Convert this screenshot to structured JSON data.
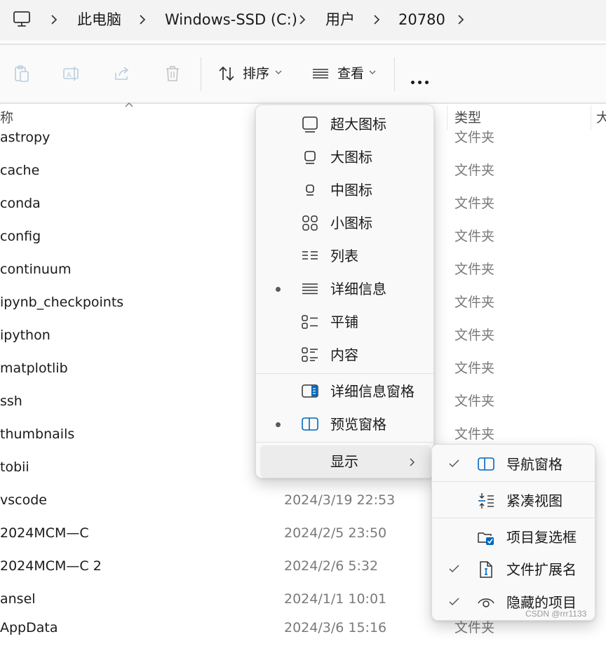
{
  "breadcrumb": {
    "root_icon": "computer-icon",
    "items": [
      "此电脑",
      "Windows-SSD (C:)",
      "用户",
      "20780"
    ]
  },
  "toolbar": {
    "sort_label": "排序",
    "view_label": "查看",
    "icons": [
      "paste-icon",
      "rename-icon",
      "share-icon",
      "delete-icon",
      "sort-icon",
      "view-icon",
      "more-icon"
    ]
  },
  "columns": {
    "name": "称",
    "type": "类型",
    "size": "大"
  },
  "files": [
    {
      "name": "astropy",
      "date": "",
      "type": "文件夹"
    },
    {
      "name": "cache",
      "date": "",
      "type": "文件夹"
    },
    {
      "name": "conda",
      "date": "",
      "type": "文件夹"
    },
    {
      "name": "config",
      "date": "",
      "type": "文件夹"
    },
    {
      "name": "continuum",
      "date": "",
      "type": "文件夹"
    },
    {
      "name": "ipynb_checkpoints",
      "date": "",
      "type": "文件夹"
    },
    {
      "name": "ipython",
      "date": "",
      "type": "文件夹"
    },
    {
      "name": "matplotlib",
      "date": "",
      "type": "文件夹"
    },
    {
      "name": "ssh",
      "date": "",
      "type": "文件夹"
    },
    {
      "name": "thumbnails",
      "date": "",
      "type": "文件夹"
    },
    {
      "name": "tobii",
      "date": "",
      "type": ""
    },
    {
      "name": "vscode",
      "date": "2024/3/19 22:53",
      "type": ""
    },
    {
      "name": "2024MCM—C",
      "date": "2024/2/5 23:50",
      "type": ""
    },
    {
      "name": "2024MCM—C  2",
      "date": "2024/2/6 5:32",
      "type": ""
    },
    {
      "name": "ansel",
      "date": "2024/1/1 10:01",
      "type": ""
    },
    {
      "name": "AppData",
      "date": "2024/3/6 15:16",
      "type": "文件夹"
    }
  ],
  "view_menu": {
    "items": [
      {
        "label": "超大图标",
        "icon": "extra-large-icons-icon",
        "selected": false
      },
      {
        "label": "大图标",
        "icon": "large-icons-icon",
        "selected": false
      },
      {
        "label": "中图标",
        "icon": "medium-icons-icon",
        "selected": false
      },
      {
        "label": "小图标",
        "icon": "small-icons-icon",
        "selected": false
      },
      {
        "label": "列表",
        "icon": "list-icon",
        "selected": false
      },
      {
        "label": "详细信息",
        "icon": "details-icon",
        "selected": true
      },
      {
        "label": "平铺",
        "icon": "tiles-icon",
        "selected": false
      },
      {
        "label": "内容",
        "icon": "content-icon",
        "selected": false
      }
    ],
    "panes": [
      {
        "label": "详细信息窗格",
        "icon": "details-pane-icon",
        "selected": false
      },
      {
        "label": "预览窗格",
        "icon": "preview-pane-icon",
        "selected": true
      }
    ],
    "show_label": "显示"
  },
  "show_submenu": {
    "items": [
      {
        "label": "导航窗格",
        "icon": "navigation-pane-icon",
        "checked": true
      },
      {
        "label": "紧凑视图",
        "icon": "compact-view-icon",
        "checked": false
      },
      {
        "label": "项目复选框",
        "icon": "item-checkboxes-icon",
        "checked": false
      },
      {
        "label": "文件扩展名",
        "icon": "file-extensions-icon",
        "checked": true
      },
      {
        "label": "隐藏的项目",
        "icon": "hidden-items-icon",
        "checked": true
      }
    ]
  },
  "watermark": "CSDN @rrr1133",
  "colors": {
    "accent": "#0067c0",
    "menu_bg": "#f9f9f9",
    "hover_bg": "#ececec",
    "secondary_text": "#7a7a7a"
  }
}
